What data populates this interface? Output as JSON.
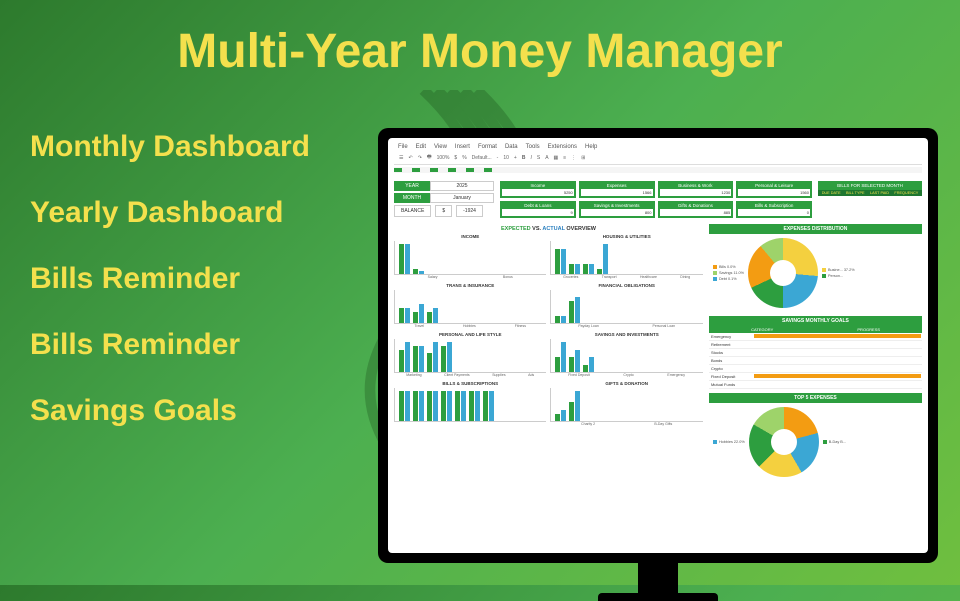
{
  "title": "Multi-Year Money Manager",
  "features": [
    "Monthly Dashboard",
    "Yearly Dashboard",
    "Bills Reminder",
    "Bills Reminder",
    "Savings Goals"
  ],
  "menu": [
    "File",
    "Edit",
    "View",
    "Insert",
    "Format",
    "Data",
    "Tools",
    "Extensions",
    "Help"
  ],
  "toolbar": {
    "font": "Default...",
    "size": "10"
  },
  "controls": {
    "year_label": "YEAR",
    "year": "2025",
    "month_label": "MONTH",
    "month": "January",
    "balance_label": "BALANCE",
    "currency": "$",
    "balance": "-1924"
  },
  "tiles": [
    {
      "label": "Income",
      "v": "5250"
    },
    {
      "label": "Expenses",
      "v": "1566"
    },
    {
      "label": "Business & Work",
      "v": "1230"
    },
    {
      "label": "Personal & Leisure",
      "v": "1560"
    },
    {
      "label": "Debt & Loans",
      "v": "9"
    },
    {
      "label": "Savings & Investments",
      "v": "800"
    },
    {
      "label": "Gifts & Donations",
      "v": "885"
    },
    {
      "label": "Bills & Subscription",
      "v": "0"
    }
  ],
  "bills_title": "BILLS FOR SELECTED MONTH",
  "bills_cols": [
    "DUE DATE",
    "BILL TYPE",
    "LAST PAID",
    "FREQUENCY"
  ],
  "overview": {
    "title_prefix": "EXPECTED",
    "title_mid": " VS. ",
    "title_act": "ACTUAL",
    "title_suffix": " OVERVIEW"
  },
  "dist_title": "EXPENSES DISTRIBUTION",
  "dist_legend": [
    {
      "l": "Bills 0.0%",
      "c": "#f39c12"
    },
    {
      "l": "Savings 11.0%",
      "c": "#9ed36a"
    },
    {
      "l": "Debt 0.1%",
      "c": "#3ba7d4"
    },
    {
      "l": "Busine... 37.2%",
      "c": "#f4d03f"
    },
    {
      "l": "Person... ",
      "c": "#2d9e3f"
    }
  ],
  "top5_title": "TOP 5 EXPENSES",
  "top5_legend": [
    {
      "l": "Hobbies 22.0%",
      "c": "#3ba7d4"
    },
    {
      "l": "B-Day B...",
      "c": "#2d9e3f"
    }
  ],
  "goals_title": "SAVINGS MONTHLY GOALS",
  "goals_cols": [
    "CATEGORY",
    "PROGRESS"
  ],
  "goals": [
    {
      "cat": "Emergency",
      "p": 100
    },
    {
      "cat": "Retirement",
      "p": 0
    },
    {
      "cat": "Stocks",
      "p": 0
    },
    {
      "cat": "Bonds",
      "p": 0
    },
    {
      "cat": "Crypto",
      "p": 0
    },
    {
      "cat": "Fixed Deposit",
      "p": 100
    },
    {
      "cat": "Mutual Funds",
      "p": 0
    }
  ],
  "chart_data": [
    {
      "type": "bar",
      "title": "INCOME",
      "categories": [
        "Salary",
        "Bonus"
      ],
      "series": [
        {
          "name": "expected",
          "values": [
            4000,
            650
          ]
        },
        {
          "name": "actual",
          "values": [
            4000,
            450
          ]
        }
      ],
      "ylim": [
        0,
        4000
      ]
    },
    {
      "type": "bar",
      "title": "HOUSING & UTILITIES",
      "categories": [
        "Groceries",
        "Transport",
        "Healthcare",
        "Dining"
      ],
      "series": [
        {
          "name": "expected",
          "values": [
            500,
            200,
            200,
            100
          ]
        },
        {
          "name": "actual",
          "values": [
            500,
            200,
            200,
            600
          ]
        }
      ],
      "ylim": [
        0,
        600
      ]
    },
    {
      "type": "bar",
      "title": "TRANS & INSURANCE",
      "categories": [
        "Travel",
        "Hobbies",
        "Fitness"
      ],
      "series": [
        {
          "name": "expected",
          "values": [
            400,
            300,
            300
          ]
        },
        {
          "name": "actual",
          "values": [
            400,
            500,
            400
          ]
        }
      ],
      "ylim": [
        0,
        800
      ]
    },
    {
      "type": "bar",
      "title": "FINANCIAL OBLIGATIONS",
      "categories": [
        "Payday Loan",
        "Personal Loan"
      ],
      "series": [
        {
          "name": "expected",
          "values": [
            200,
            600
          ]
        },
        {
          "name": "actual",
          "values": [
            200,
            700
          ]
        }
      ],
      "ylim": [
        0,
        800
      ]
    },
    {
      "type": "bar",
      "title": "PERSONAL AND LIFE STYLE",
      "categories": [
        "Marketing",
        "Client Payments",
        "Supplies",
        "Ads"
      ],
      "series": [
        {
          "name": "expected",
          "values": [
            300,
            350,
            250,
            350
          ]
        },
        {
          "name": "actual",
          "values": [
            400,
            350,
            400,
            400
          ]
        }
      ],
      "ylim": [
        0,
        400
      ]
    },
    {
      "type": "bar",
      "title": "SAVINGS AND INVESTMENTS",
      "categories": [
        "Fixed Deposit",
        "Crypto",
        "Emergency"
      ],
      "series": [
        {
          "name": "expected",
          "values": [
            200,
            200,
            100
          ]
        },
        {
          "name": "actual",
          "values": [
            400,
            300,
            200
          ]
        }
      ],
      "ylim": [
        0,
        400
      ]
    },
    {
      "type": "bar",
      "title": "BILLS & SUBSCRIPTIONS",
      "categories": [
        "",
        "",
        "",
        "",
        "",
        "",
        ""
      ],
      "series": [
        {
          "name": "expected",
          "values": [
            1,
            1,
            1,
            1,
            1,
            1,
            1
          ]
        },
        {
          "name": "actual",
          "values": [
            1,
            1,
            1,
            1,
            1,
            1,
            1
          ]
        }
      ],
      "ylim": [
        0,
        1
      ]
    },
    {
      "type": "bar",
      "title": "GIFTS & DONATION",
      "categories": [
        "Charity 2",
        "B-Day Gifts"
      ],
      "series": [
        {
          "name": "expected",
          "values": [
            200,
            500
          ]
        },
        {
          "name": "actual",
          "values": [
            300,
            800
          ]
        }
      ],
      "ylim": [
        0,
        800
      ]
    }
  ]
}
